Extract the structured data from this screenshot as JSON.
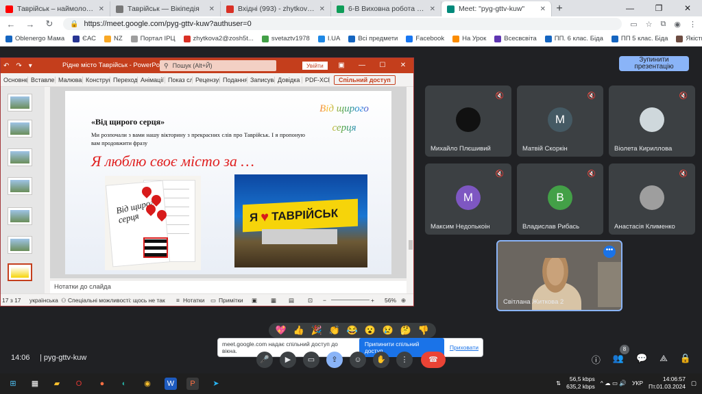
{
  "browser": {
    "tabs": [
      {
        "label": "Таврійськ – наймолодше місто",
        "icon_color": "#ff0000"
      },
      {
        "label": "Таврійськ — Вікіпедія",
        "icon_color": "#777777"
      },
      {
        "label": "Вхідні (993) - zhytkova2@zosh5t",
        "icon_color": "#d93025"
      },
      {
        "label": "6-В Виховна робота Житкова С",
        "icon_color": "#0f9d58"
      },
      {
        "label": "Meet: \"pyg-gttv-kuw\"",
        "icon_color": "#00897b",
        "active": true
      }
    ],
    "url": "https://meet.google.com/pyg-gttv-kuw?authuser=0",
    "bookmarks": [
      {
        "label": "Oblenergo Мама",
        "icon_color": "#1565c0"
      },
      {
        "label": "ЄАС",
        "icon_color": "#283593"
      },
      {
        "label": "NZ",
        "icon_color": "#f9a825"
      },
      {
        "label": "Портал ІРЦ",
        "icon_color": "#9e9e9e"
      },
      {
        "label": "zhytkova2@zosh5t...",
        "icon_color": "#d93025"
      },
      {
        "label": "svetaztv1978",
        "icon_color": "#43a047"
      },
      {
        "label": "I.UA",
        "icon_color": "#1e88e5"
      },
      {
        "label": "Всі предмети",
        "icon_color": "#1565c0"
      },
      {
        "label": "Facebook",
        "icon_color": "#1877f2"
      },
      {
        "label": "На Урок",
        "icon_color": "#fb8c00"
      },
      {
        "label": "Всесвсвіта",
        "icon_color": "#5e35b1"
      },
      {
        "label": "ПП. 6 клас. Біда",
        "icon_color": "#1565c0"
      },
      {
        "label": "ПП 5 клас. Біда",
        "icon_color": "#1565c0"
      },
      {
        "label": "Якість освіти",
        "icon_color": "#6d4c41"
      }
    ]
  },
  "meet": {
    "stop_presenting": "Зупинити презентацію",
    "participants": [
      {
        "name": "Михайло Плєшивий",
        "avatar_letter": "",
        "avatar_color": "#111111"
      },
      {
        "name": "Матвій Скоркін",
        "avatar_letter": "M",
        "avatar_color": "#455a64"
      },
      {
        "name": "Віолета Кириллова",
        "avatar_letter": "",
        "avatar_color": "#cfd8dc"
      },
      {
        "name": "Максим Недопькоін",
        "avatar_letter": "M",
        "avatar_color": "#7e57c2"
      },
      {
        "name": "Владислав Рибась",
        "avatar_letter": "B",
        "avatar_color": "#43a047"
      },
      {
        "name": "Анастасія Клименко",
        "avatar_letter": "",
        "avatar_color": "#9e9e9e"
      }
    ],
    "self_tile_name": "Світлана Житкова 2",
    "reactions": [
      "💖",
      "👍",
      "🎉",
      "👏",
      "😂",
      "😮",
      "😢",
      "🤔",
      "👎"
    ],
    "share_notice": {
      "text": "meet.google.com надає спільний доступ до вікна.",
      "stop": "Припинити спільний доступ",
      "hide": "Приховати"
    },
    "time": "14:06",
    "code": "pyg-gttv-kuw",
    "people_count": "8"
  },
  "powerpoint": {
    "title": "Рідне місто Таврійськ - PowerPoint",
    "search": "Пошук (Alt+Й)",
    "signin": "Увійти",
    "ribbon_tabs": [
      "Основне",
      "Вставлення",
      "Малювання",
      "Конструктор",
      "Переходи",
      "Анімації",
      "Показ слайдів",
      "Рецензування",
      "Подання",
      "Записування",
      "Довідка",
      "PDF-XChange"
    ],
    "share": "Спільний доступ",
    "notes_placeholder": "Нотатки до слайда",
    "status": {
      "slide": "17 з 17",
      "language": "українська",
      "accessibility": "Спеціальні можливості: щось не так",
      "notes": "Нотатки",
      "comments": "Примітки",
      "zoom": "56%"
    },
    "slide": {
      "heading": "«Від щирого серця»",
      "body": "Ми розпочали з вами нашу вікторину з прекрасних слів про Таврійськ. І я пропоную вам продовжити фразу",
      "big_line": "Я люблю своє місто за …",
      "wordart": "Від щирого серця",
      "card_text": "Від щирого серця",
      "sign_text_1": "Я",
      "sign_text_2": "ТАВРІЙСЬК"
    }
  },
  "taskbar": {
    "net_up": "56,5 kbps",
    "net_down": "635,2 kbps",
    "lang": "УКР",
    "time": "14:06:57",
    "date": "Пт.01.03.2024"
  }
}
